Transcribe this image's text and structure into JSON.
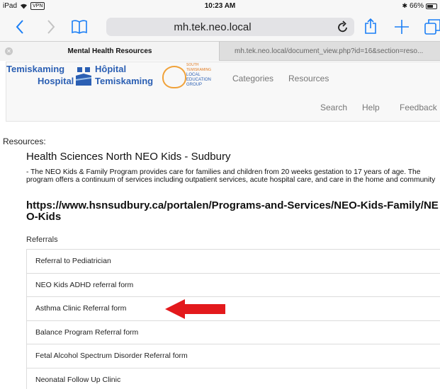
{
  "status_bar": {
    "device": "iPad",
    "vpn": "VPN",
    "time": "10:23 AM",
    "battery": "66%",
    "battery_level": 0.66
  },
  "browser": {
    "url": "mh.tek.neo.local",
    "tabs": [
      {
        "label": "Mental Health Resources",
        "active": true
      },
      {
        "label": "mh.tek.neo.local/document_view.php?id=16&section=reso...",
        "active": false
      }
    ]
  },
  "site": {
    "logo": {
      "line1": "Temiskaming",
      "line2": "Hospital",
      "line3": "Hôpital",
      "line4": "Temiskaming"
    },
    "group_logo": {
      "line1": "SOUTH TEMISKAMING",
      "line2": "LOCAL",
      "line3": "EDUCATION",
      "line4": "GROUP"
    },
    "nav_top": [
      "Categories",
      "Resources"
    ],
    "nav_bottom": [
      "Search",
      "Help",
      "Feedback"
    ]
  },
  "content": {
    "resources_label": "Resources:",
    "provider_title": "Health Sciences North NEO Kids - Sudbury",
    "provider_description": "- The NEO Kids & Family Program provides care for families and children from 20 weeks gestation to 17 years of age. The program offers a continuum of services including outpatient services, acute hospital care, and care in the home and community",
    "provider_url": "https://www.hsnsudbury.ca/portalen/Programs-and-Services/NEO-Kids-Family/NEO-Kids",
    "referrals_label": "Referrals",
    "referrals": [
      "Referral to Pediatrician",
      "NEO Kids ADHD referral form",
      "Asthma Clinic Referral form",
      "Balance Program Referral form",
      "Fetal Alcohol Spectrum Disorder Referral form",
      "Neonatal Follow Up Clinic"
    ]
  },
  "colors": {
    "ios_blue": "#1a7ef5",
    "logo_blue": "#2b5fb3",
    "arrow_red": "#e3191c"
  },
  "icons": {
    "back": "chevron-left-icon",
    "forward": "chevron-right-icon",
    "bookmarks": "book-icon",
    "reload": "reload-icon",
    "share": "share-icon",
    "new_tab": "plus-icon",
    "tabs": "tabs-icon"
  }
}
